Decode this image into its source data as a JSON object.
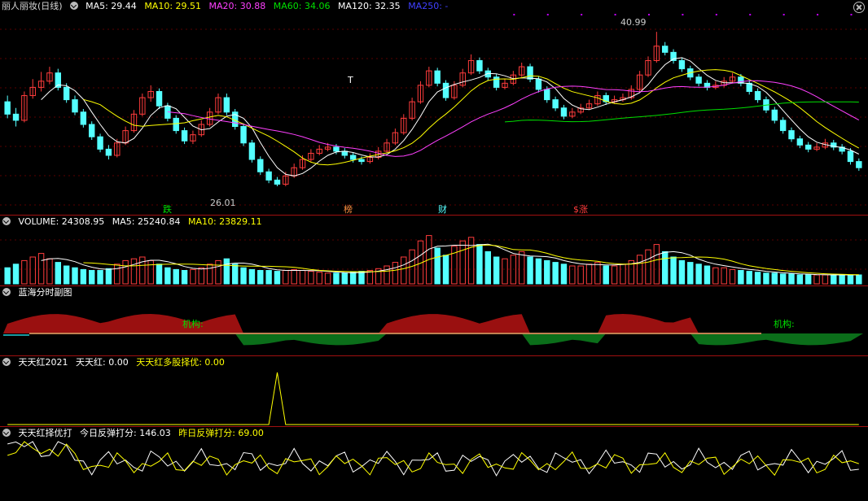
{
  "main": {
    "stock_title": "丽人丽妆(日线)",
    "ma5": "MA5: 29.44",
    "ma10": "MA10: 29.51",
    "ma20": "MA20: 30.88",
    "ma60": "MA60: 34.06",
    "ma120": "MA120: 32.35",
    "ma250": "MA250: -",
    "high_label": "40.99",
    "low_label": "26.01",
    "t_marker": "T",
    "signals": {
      "die": "跌",
      "bang": "榜",
      "cai": "财",
      "zhang": "涨",
      "zhang_prefix": "$"
    }
  },
  "volume": {
    "volume": "VOLUME: 24308.95",
    "ma5": "MA5: 25240.84",
    "ma10": "MA10: 23829.11"
  },
  "lanhai": {
    "title": "蓝海分时副图",
    "label_1": "机构:",
    "label_2": "机构:"
  },
  "tiantianhong": {
    "title": "天天红2021",
    "value": "天天红: 0.00",
    "multi": "天天红多股择优: 0.00"
  },
  "score": {
    "title": "天天红择优打",
    "today": "今日反弹打分: 146.03",
    "yesterday": "昨日反弹打分: 69.00"
  },
  "colors": {
    "up": "#ff3c3c",
    "down": "#54ffff",
    "ma5": "#ffffff",
    "ma10": "#ffff00",
    "ma20": "#ff40ff",
    "ma60": "#00e000",
    "ma120": "#ffffff",
    "ma250": "#4040ff"
  },
  "chart_data": {
    "type": "candlestick",
    "price_range": [
      24.5,
      42.5
    ],
    "high": 40.99,
    "low": 26.01,
    "candles_ohlc": [
      [
        34.2,
        33.0,
        34.8,
        32.6
      ],
      [
        33.0,
        32.4,
        33.6,
        31.8
      ],
      [
        32.4,
        34.8,
        35.2,
        32.2
      ],
      [
        34.8,
        35.6,
        36.4,
        34.5
      ],
      [
        35.6,
        36.2,
        37.1,
        35.2
      ],
      [
        36.2,
        37.0,
        37.6,
        35.9
      ],
      [
        37.0,
        35.6,
        37.4,
        35.3
      ],
      [
        35.6,
        34.4,
        36.0,
        34.1
      ],
      [
        34.4,
        33.2,
        34.8,
        32.9
      ],
      [
        33.2,
        32.0,
        33.5,
        31.7
      ],
      [
        32.0,
        30.8,
        32.3,
        30.5
      ],
      [
        30.8,
        29.6,
        31.1,
        29.3
      ],
      [
        29.6,
        29.0,
        30.0,
        28.6
      ],
      [
        29.0,
        30.2,
        30.6,
        28.8
      ],
      [
        30.2,
        31.4,
        31.8,
        30.0
      ],
      [
        31.4,
        33.0,
        33.4,
        31.2
      ],
      [
        33.0,
        34.6,
        35.0,
        32.8
      ],
      [
        34.6,
        35.2,
        35.8,
        34.2
      ],
      [
        35.2,
        33.8,
        35.5,
        33.5
      ],
      [
        33.8,
        32.6,
        34.1,
        32.3
      ],
      [
        32.6,
        31.4,
        32.9,
        31.1
      ],
      [
        31.4,
        30.4,
        31.7,
        30.1
      ],
      [
        30.4,
        31.0,
        31.4,
        30.1
      ],
      [
        31.0,
        32.0,
        32.4,
        30.8
      ],
      [
        32.0,
        33.2,
        33.6,
        31.8
      ],
      [
        33.2,
        34.6,
        35.0,
        33.0
      ],
      [
        34.6,
        33.2,
        35.0,
        32.9
      ],
      [
        33.2,
        31.8,
        33.5,
        31.5
      ],
      [
        31.8,
        30.2,
        32.1,
        29.9
      ],
      [
        30.2,
        28.6,
        30.5,
        28.3
      ],
      [
        28.6,
        27.4,
        28.9,
        27.1
      ],
      [
        27.4,
        26.6,
        27.7,
        26.3
      ],
      [
        26.6,
        26.2,
        26.9,
        26.0
      ],
      [
        26.2,
        27.0,
        27.4,
        26.0
      ],
      [
        27.0,
        27.8,
        28.2,
        26.8
      ],
      [
        27.8,
        28.6,
        29.0,
        27.6
      ],
      [
        28.6,
        29.2,
        29.6,
        28.4
      ],
      [
        29.2,
        29.6,
        30.0,
        29.0
      ],
      [
        29.6,
        29.8,
        30.2,
        29.4
      ],
      [
        29.8,
        29.4,
        30.1,
        29.1
      ],
      [
        29.4,
        29.0,
        29.7,
        28.7
      ],
      [
        29.0,
        28.6,
        29.3,
        28.3
      ],
      [
        28.6,
        28.4,
        28.9,
        28.1
      ],
      [
        28.4,
        28.8,
        29.2,
        28.2
      ],
      [
        28.8,
        29.4,
        29.8,
        28.6
      ],
      [
        29.4,
        30.2,
        30.6,
        29.2
      ],
      [
        30.2,
        31.2,
        31.6,
        30.0
      ],
      [
        31.2,
        32.6,
        33.0,
        31.0
      ],
      [
        32.6,
        34.2,
        34.6,
        32.4
      ],
      [
        34.2,
        35.8,
        36.2,
        34.0
      ],
      [
        35.8,
        37.2,
        37.6,
        35.6
      ],
      [
        37.2,
        36.0,
        37.5,
        35.7
      ],
      [
        36.0,
        34.6,
        36.3,
        34.3
      ],
      [
        34.6,
        35.8,
        36.2,
        34.4
      ],
      [
        35.8,
        37.0,
        37.4,
        35.6
      ],
      [
        37.0,
        38.2,
        38.8,
        36.8
      ],
      [
        38.2,
        37.2,
        38.5,
        36.9
      ],
      [
        37.2,
        36.6,
        37.5,
        36.3
      ],
      [
        36.6,
        35.6,
        36.9,
        35.3
      ],
      [
        35.6,
        36.0,
        36.4,
        35.4
      ],
      [
        36.0,
        36.8,
        37.2,
        35.8
      ],
      [
        36.8,
        37.6,
        38.0,
        36.6
      ],
      [
        37.6,
        36.4,
        37.9,
        36.1
      ],
      [
        36.4,
        35.4,
        36.7,
        35.1
      ],
      [
        35.4,
        34.4,
        35.7,
        34.1
      ],
      [
        34.4,
        33.6,
        34.7,
        33.3
      ],
      [
        33.6,
        32.8,
        33.9,
        32.5
      ],
      [
        32.8,
        33.2,
        33.6,
        32.6
      ],
      [
        33.2,
        33.6,
        34.0,
        33.0
      ],
      [
        33.6,
        34.0,
        34.4,
        33.4
      ],
      [
        34.0,
        34.8,
        35.2,
        33.8
      ],
      [
        34.8,
        34.2,
        35.1,
        33.9
      ],
      [
        34.2,
        34.4,
        34.8,
        34.0
      ],
      [
        34.4,
        34.6,
        35.0,
        34.2
      ],
      [
        34.6,
        35.4,
        35.8,
        34.4
      ],
      [
        35.4,
        36.8,
        37.2,
        35.2
      ],
      [
        36.8,
        38.2,
        38.6,
        36.6
      ],
      [
        38.2,
        39.6,
        40.99,
        38.0
      ],
      [
        39.6,
        39.0,
        40.0,
        38.7
      ],
      [
        39.0,
        38.2,
        39.3,
        37.9
      ],
      [
        38.2,
        37.4,
        38.5,
        37.1
      ],
      [
        37.4,
        36.6,
        37.7,
        36.3
      ],
      [
        36.6,
        36.0,
        36.9,
        35.7
      ],
      [
        36.0,
        35.6,
        36.3,
        35.3
      ],
      [
        35.6,
        35.8,
        36.2,
        35.4
      ],
      [
        35.8,
        36.2,
        36.6,
        35.6
      ],
      [
        36.2,
        36.6,
        37.0,
        36.0
      ],
      [
        36.6,
        36.0,
        36.9,
        35.7
      ],
      [
        36.0,
        35.2,
        36.3,
        34.9
      ],
      [
        35.2,
        34.4,
        35.5,
        34.1
      ],
      [
        34.4,
        33.4,
        34.7,
        33.1
      ],
      [
        33.4,
        32.4,
        33.7,
        32.1
      ],
      [
        32.4,
        31.4,
        32.7,
        31.1
      ],
      [
        31.4,
        30.6,
        31.7,
        30.3
      ],
      [
        30.6,
        30.0,
        30.9,
        29.7
      ],
      [
        30.0,
        29.6,
        30.3,
        29.3
      ],
      [
        29.6,
        29.8,
        30.2,
        29.4
      ],
      [
        29.8,
        30.2,
        30.6,
        29.6
      ],
      [
        30.2,
        29.8,
        30.5,
        29.5
      ],
      [
        29.8,
        29.4,
        30.1,
        29.1
      ],
      [
        29.4,
        28.4,
        29.7,
        28.1
      ],
      [
        28.4,
        27.8,
        28.7,
        27.5
      ]
    ],
    "volume_range": [
      0,
      60000
    ],
    "volume": [
      18000,
      22000,
      26000,
      30000,
      34000,
      28000,
      24000,
      20000,
      18000,
      16000,
      15000,
      15000,
      17000,
      22000,
      26000,
      28000,
      30000,
      26000,
      22000,
      18000,
      16000,
      15000,
      16000,
      18000,
      22000,
      26000,
      28000,
      22000,
      18000,
      16000,
      15000,
      15000,
      14000,
      15000,
      16000,
      15000,
      14000,
      13000,
      12000,
      12000,
      12000,
      13000,
      14000,
      15000,
      17000,
      20000,
      24000,
      30000,
      38000,
      48000,
      54000,
      40000,
      32000,
      42000,
      48000,
      52000,
      44000,
      36000,
      30000,
      28000,
      32000,
      36000,
      30000,
      28000,
      26000,
      24000,
      22000,
      20000,
      20000,
      22000,
      24000,
      20000,
      20000,
      22000,
      26000,
      32000,
      38000,
      44000,
      36000,
      30000,
      26000,
      24000,
      22000,
      20000,
      18000,
      18000,
      16000,
      15000,
      14000,
      13000,
      12000,
      12000,
      11000,
      11000,
      10000,
      10000,
      10000,
      10000,
      10000,
      10000,
      10000,
      10000
    ],
    "lanhai_area": [
      1,
      1,
      1,
      1,
      1,
      1,
      1,
      1,
      1,
      1,
      1,
      1,
      1,
      1,
      1,
      1,
      1,
      1,
      1,
      1,
      1,
      1,
      1,
      1,
      1,
      1,
      1,
      1,
      -1,
      -1,
      -1,
      -1,
      -1,
      -1,
      -1,
      -1,
      -1,
      -1,
      -1,
      -1,
      -1,
      -1,
      -1,
      -1,
      -1,
      1,
      1,
      1,
      1,
      1,
      1,
      1,
      1,
      1,
      1,
      1,
      1,
      1,
      1,
      1,
      1,
      1,
      -1,
      -1,
      -1,
      -1,
      -1,
      -1,
      -1,
      -1,
      -1,
      1,
      1,
      1,
      1,
      1,
      1,
      1,
      1,
      1,
      1,
      1,
      -1,
      -1,
      -1,
      -1,
      -1,
      -1,
      -1,
      -1,
      -1,
      -1,
      -1,
      -1,
      -1,
      -1,
      -1,
      -1,
      -1,
      -1,
      -1
    ],
    "tiantianhong_series": [
      0,
      0,
      0,
      0,
      0,
      0,
      0,
      0,
      0,
      0,
      0,
      0,
      0,
      0,
      0,
      0,
      0,
      0,
      0,
      0,
      0,
      0,
      0,
      0,
      0,
      0,
      0,
      0,
      0,
      0,
      0,
      0,
      1,
      0,
      0,
      0,
      0,
      0,
      0,
      0,
      0,
      0,
      0,
      0,
      0,
      0,
      0,
      0,
      0,
      0,
      0,
      0,
      0,
      0,
      0,
      0,
      0,
      0,
      0,
      0,
      0,
      0,
      0,
      0,
      0,
      0,
      0,
      0,
      0,
      0,
      0,
      0,
      0,
      0,
      0,
      0,
      0,
      0,
      0,
      0,
      0,
      0,
      0,
      0,
      0,
      0,
      0,
      0,
      0,
      0,
      0,
      0,
      0,
      0,
      0,
      0,
      0,
      0,
      0,
      0,
      0,
      0
    ]
  }
}
